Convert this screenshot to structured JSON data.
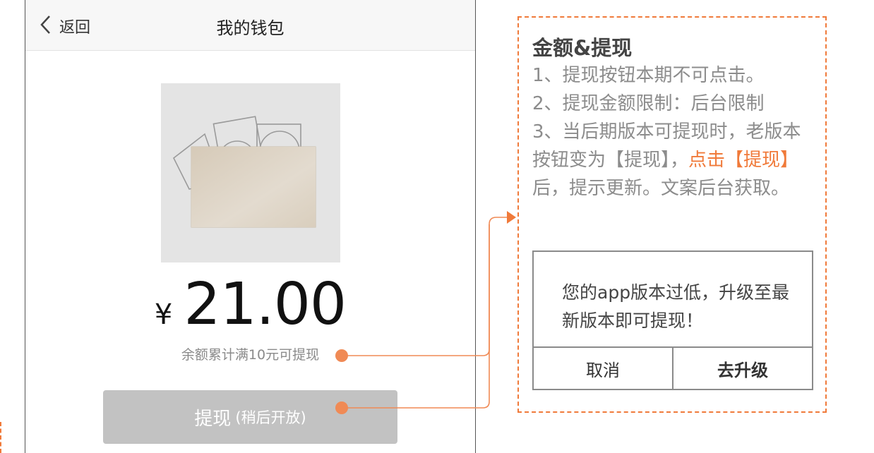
{
  "phone": {
    "nav": {
      "back_label": "返回",
      "title": "我的钱包"
    },
    "wallet": {
      "image_icon": "wallet-cards-illustration",
      "currency": "¥",
      "amount": "21.00",
      "hint": "余额累计满10元可提现"
    },
    "withdraw_button": {
      "label": "提现",
      "sub_label": "(稍后开放)"
    }
  },
  "annotation": {
    "title": "金额&提现",
    "line1": "1、提现按钮本期不可点击。",
    "line2": "2、提现金额限制：后台限制",
    "line3_a": "3、当后期版本可提现时，老版本按钮变为【提现】，",
    "line3_hl": "点击【提现】",
    "line3_b": "后，提示更新。文案后台获取。",
    "dialog": {
      "message": "您的app版本过低，升级至最新版本即可提现！",
      "cancel_label": "取消",
      "confirm_label": "去升级"
    }
  },
  "colors": {
    "accent": "#f07a3a",
    "disabled_button": "#c2c2c2",
    "annotation_text": "#8c8c8c"
  }
}
